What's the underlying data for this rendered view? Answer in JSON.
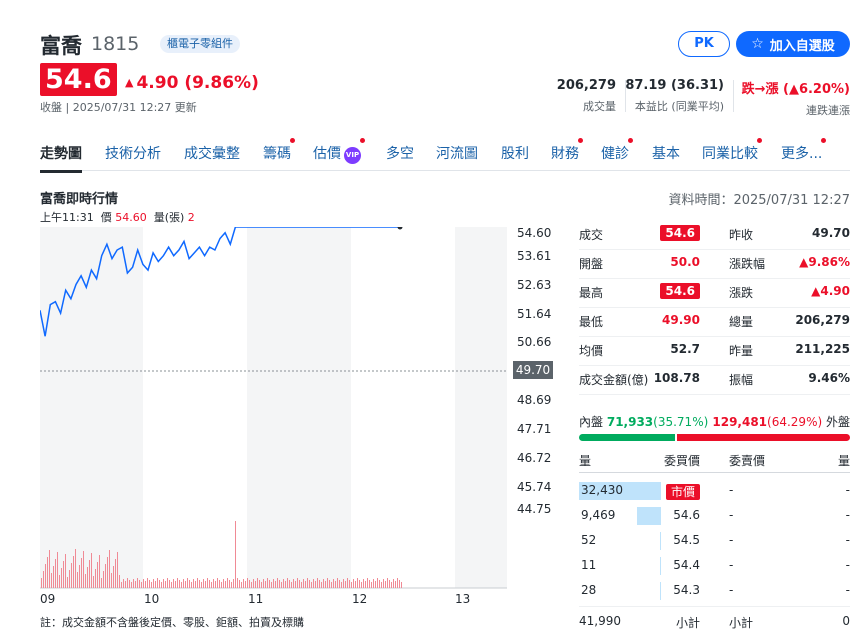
{
  "header": {
    "name": "富喬",
    "code": "1815",
    "tag": "櫃電子零組件",
    "pk_label": "PK",
    "add_label": "加入自選股",
    "price": "54.6",
    "change": "4.90 (9.86%)",
    "status": "收盤 | 2025/07/31 12:27 更新"
  },
  "key_stats": [
    {
      "value": "206,279",
      "label": "成交量"
    },
    {
      "value": "87.19 (36.31)",
      "label": "本益比 (同業平均)"
    },
    {
      "value": "跌→漲 (▲6.20%)",
      "label": "連跌連漲"
    }
  ],
  "nav": [
    {
      "label": "走勢圖",
      "dot": false,
      "vip": false
    },
    {
      "label": "技術分析",
      "dot": false,
      "vip": false
    },
    {
      "label": "成交彙整",
      "dot": false,
      "vip": false
    },
    {
      "label": "籌碼",
      "dot": true,
      "vip": false
    },
    {
      "label": "估價",
      "dot": true,
      "vip": true
    },
    {
      "label": "多空",
      "dot": false,
      "vip": false
    },
    {
      "label": "河流圖",
      "dot": false,
      "vip": false
    },
    {
      "label": "股利",
      "dot": false,
      "vip": false
    },
    {
      "label": "財務",
      "dot": true,
      "vip": false
    },
    {
      "label": "健診",
      "dot": true,
      "vip": false
    },
    {
      "label": "基本",
      "dot": false,
      "vip": false
    },
    {
      "label": "同業比較",
      "dot": true,
      "vip": false
    },
    {
      "label": "更多...",
      "dot": true,
      "vip": false
    }
  ],
  "vip_text": "VIP",
  "section": {
    "title": "富喬即時行情",
    "data_time": "資料時間：2025/07/31 12:27",
    "hover_time": "上午11:31",
    "hover_price_label": "價",
    "hover_price": "54.60",
    "hover_vol_label": "量(張)",
    "hover_vol": "2"
  },
  "chart_data": {
    "type": "line",
    "y_ticks": [
      "54.60",
      "53.61",
      "52.63",
      "51.64",
      "50.66",
      "48.69",
      "47.71",
      "46.72",
      "45.74",
      "44.75"
    ],
    "prev_close": "49.70",
    "x_ticks": [
      "09",
      "10",
      "11",
      "12",
      "13"
    ],
    "price_series": [
      [
        0,
        51.7
      ],
      [
        1,
        50.8
      ],
      [
        2,
        51.9
      ],
      [
        3,
        52.0
      ],
      [
        4,
        51.6
      ],
      [
        5,
        52.4
      ],
      [
        6,
        52.1
      ],
      [
        7,
        52.6
      ],
      [
        8,
        52.9
      ],
      [
        9,
        52.5
      ],
      [
        10,
        53.1
      ],
      [
        11,
        52.8
      ],
      [
        12,
        53.6
      ],
      [
        13,
        54.0
      ],
      [
        14,
        53.5
      ],
      [
        15,
        53.8
      ],
      [
        16,
        53.9
      ],
      [
        17,
        53.0
      ],
      [
        18,
        53.2
      ],
      [
        19,
        53.8
      ],
      [
        20,
        53.3
      ],
      [
        21,
        53.1
      ],
      [
        22,
        53.7
      ],
      [
        23,
        53.4
      ],
      [
        24,
        53.6
      ],
      [
        25,
        53.9
      ],
      [
        26,
        53.6
      ],
      [
        27,
        53.8
      ],
      [
        28,
        54.1
      ],
      [
        29,
        53.5
      ],
      [
        30,
        53.7
      ],
      [
        31,
        53.9
      ],
      [
        32,
        53.6
      ],
      [
        33,
        53.9
      ],
      [
        34,
        53.8
      ],
      [
        35,
        54.2
      ],
      [
        36,
        54.4
      ],
      [
        37,
        54.0
      ],
      [
        38,
        54.6
      ],
      [
        39,
        54.6
      ],
      [
        40,
        54.6
      ],
      [
        41,
        54.6
      ],
      [
        42,
        54.6
      ],
      [
        43,
        54.6
      ],
      [
        44,
        54.6
      ],
      [
        45,
        54.6
      ],
      [
        46,
        54.6
      ],
      [
        47,
        54.6
      ],
      [
        48,
        54.6
      ],
      [
        49,
        54.6
      ],
      [
        50,
        54.6
      ],
      [
        51,
        54.6
      ],
      [
        52,
        54.6
      ],
      [
        53,
        54.6
      ],
      [
        54,
        54.6
      ],
      [
        55,
        54.6
      ],
      [
        56,
        54.6
      ],
      [
        57,
        54.6
      ],
      [
        58,
        54.6
      ],
      [
        59,
        54.6
      ],
      [
        60,
        54.6
      ],
      [
        61,
        54.6
      ],
      [
        62,
        54.6
      ],
      [
        63,
        54.6
      ],
      [
        64,
        54.6
      ],
      [
        65,
        54.6
      ],
      [
        66,
        54.6
      ],
      [
        67,
        54.6
      ],
      [
        68,
        54.6
      ],
      [
        69,
        54.6
      ],
      [
        70,
        54.6
      ]
    ],
    "ylim": [
      44.75,
      54.6
    ],
    "grid": true
  },
  "note": "註：成交金額不含盤後定價、零股、鉅額、拍賣及標購",
  "quotes": [
    {
      "l1": "成交",
      "v1": "54.6",
      "box1": true,
      "c1": "up",
      "l2": "昨收",
      "v2": "49.70",
      "c2": ""
    },
    {
      "l1": "開盤",
      "v1": "50.0",
      "box1": false,
      "c1": "up",
      "l2": "漲跌幅",
      "v2": "▲9.86%",
      "c2": "up"
    },
    {
      "l1": "最高",
      "v1": "54.6",
      "box1": true,
      "c1": "up",
      "l2": "漲跌",
      "v2": "▲4.90",
      "c2": "up"
    },
    {
      "l1": "最低",
      "v1": "49.90",
      "box1": false,
      "c1": "up",
      "l2": "總量",
      "v2": "206,279",
      "c2": ""
    },
    {
      "l1": "均價",
      "v1": "52.7",
      "box1": false,
      "c1": "",
      "l2": "昨量",
      "v2": "211,225",
      "c2": ""
    },
    {
      "l1": "成交金額(億)",
      "v1": "108.78",
      "box1": false,
      "c1": "",
      "l2": "振幅",
      "v2": "9.46%",
      "c2": ""
    }
  ],
  "inout": {
    "in_label": "內盤",
    "in_value": "71,933",
    "in_pct": "(35.71%)",
    "out_value": "129,481",
    "out_pct": "(64.29%)",
    "out_label": "外盤",
    "in_fraction": 0.3571
  },
  "orderbook": {
    "headers": [
      "量",
      "委買價",
      "委賣價",
      "量"
    ],
    "rows": [
      {
        "bvol": "32,430",
        "bprice": "市價",
        "sprice": "-",
        "svol": "-",
        "bar": 1.0
      },
      {
        "bvol": "9,469",
        "bprice": "54.6",
        "sprice": "-",
        "svol": "-",
        "bar": 0.29
      },
      {
        "bvol": "52",
        "bprice": "54.5",
        "sprice": "-",
        "svol": "-",
        "bar": 0.01
      },
      {
        "bvol": "11",
        "bprice": "54.4",
        "sprice": "-",
        "svol": "-",
        "bar": 0.0
      },
      {
        "bvol": "28",
        "bprice": "54.3",
        "sprice": "-",
        "svol": "-",
        "bar": 0.01
      }
    ],
    "total_bvol": "41,990",
    "subtotal_label": "小計",
    "total_svol": "0"
  }
}
